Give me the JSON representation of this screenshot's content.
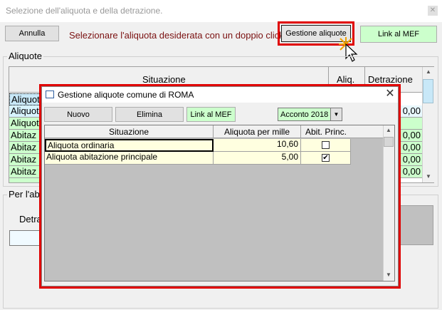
{
  "parent": {
    "title": "Selezione dell'aliquota e della detrazione.",
    "annulla_label": "Annulla",
    "instruction": "Selezionare l'aliquota desiderata con un doppio click",
    "gestione_label": "Gestione aliquote",
    "link_mef_label": "Link al MEF",
    "aliquote_group_label": "Aliquote",
    "table": {
      "headers": [
        "Situazione",
        "Aliq.",
        "Detrazione"
      ],
      "rows": [
        {
          "situazione": "Aliquot",
          "detrazione": ""
        },
        {
          "situazione": "Aliquot",
          "detrazione": "0,00"
        },
        {
          "situazione": "Aliquot",
          "detrazione": ""
        },
        {
          "situazione": "Abitaz",
          "detrazione": "0,00"
        },
        {
          "situazione": "Abitaz",
          "detrazione": "0,00"
        },
        {
          "situazione": "Abitaz",
          "detrazione": "0,00"
        },
        {
          "situazione": "Abitaz",
          "detrazione": "0,00"
        }
      ]
    },
    "per_group_label": "Per l'ab",
    "detra_label": "Detra"
  },
  "dialog": {
    "title": "Gestione aliquote comune di ROMA",
    "nuovo_label": "Nuovo",
    "elimina_label": "Elimina",
    "link_mef_label": "Link al MEF",
    "acconto_value": "Acconto 2018",
    "headers": [
      "Situazione",
      "Aliquota per mille",
      "Abit. Princ."
    ],
    "rows": [
      {
        "situazione": "Aliquota ordinaria",
        "aliquota": "10,60",
        "abit_princ": false
      },
      {
        "situazione": "Aliquota abitazione principale",
        "aliquota": "5,00",
        "abit_princ": true
      }
    ]
  },
  "colors": {
    "highlight": "#e00000",
    "green_button": "#ccffcc",
    "cell_yellow": "#ffffe0",
    "instruction_red": "#7a1010"
  }
}
